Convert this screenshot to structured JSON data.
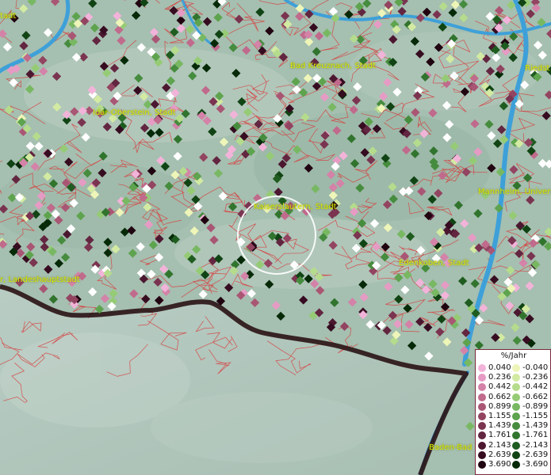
{
  "map": {
    "cities": [
      {
        "id": "city-stadt-topleft",
        "label": "tadt"
      },
      {
        "id": "city-bad-kreuznach",
        "label": "Bad Kreuznach, Stadt"
      },
      {
        "id": "city-riedstadt",
        "label": "Riedst"
      },
      {
        "id": "city-idar-oberstein",
        "label": "Idar-Oberstein, Stadt"
      },
      {
        "id": "city-mannheim",
        "label": "Mannheim, Univers"
      },
      {
        "id": "city-kaiserslautern",
        "label": "Kaiserslautern, Stadt"
      },
      {
        "id": "city-landeshauptstadt",
        "label": "r, Landeshauptstadt"
      },
      {
        "id": "city-edenkoben",
        "label": "Edenkoben, Stadt"
      },
      {
        "id": "city-baden-baden",
        "label": "Baden-Bad"
      }
    ]
  },
  "legend": {
    "title": "%/Jahr",
    "positive": [
      {
        "label": "0.040",
        "color": "#f2b3d9"
      },
      {
        "label": "0.236",
        "color": "#e69bc4"
      },
      {
        "label": "0.442",
        "color": "#d482a8"
      },
      {
        "label": "0.662",
        "color": "#c06a8c"
      },
      {
        "label": "0.899",
        "color": "#a95674"
      },
      {
        "label": "1.155",
        "color": "#924460"
      },
      {
        "label": "1.439",
        "color": "#7a3450"
      },
      {
        "label": "1.761",
        "color": "#632640"
      },
      {
        "label": "2.143",
        "color": "#4c1830"
      },
      {
        "label": "2.639",
        "color": "#360c20"
      },
      {
        "label": "3.690",
        "color": "#200410"
      }
    ],
    "negative": [
      {
        "label": "-0.040",
        "color": "#eef5b8"
      },
      {
        "label": "-0.236",
        "color": "#d3eaa2"
      },
      {
        "label": "-0.442",
        "color": "#b5dc8c"
      },
      {
        "label": "-0.662",
        "color": "#96cb76"
      },
      {
        "label": "-0.899",
        "color": "#78b862"
      },
      {
        "label": "-1.155",
        "color": "#5ea34e"
      },
      {
        "label": "-1.439",
        "color": "#468c3e"
      },
      {
        "label": "-1.761",
        "color": "#31742e"
      },
      {
        "label": "-2.143",
        "color": "#1f5c20"
      },
      {
        "label": "-2.639",
        "color": "#114414"
      },
      {
        "label": "-3.690",
        "color": "#062a08"
      }
    ]
  },
  "colors": {
    "terrain": "#a9c2b4",
    "lowland": "#b9cdc4",
    "boundary": "#d93a3a",
    "river": "#3ea0d8",
    "state_border": "#2a1214",
    "label": "#d8e600",
    "marker_white": "#ffffff"
  }
}
